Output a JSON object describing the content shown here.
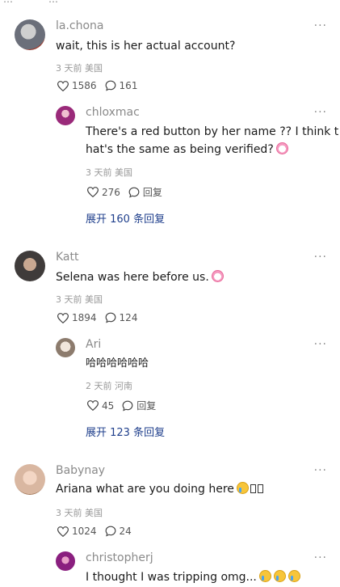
{
  "top_fragment": [
    "…",
    "…"
  ],
  "comments": [
    {
      "username": "la.chona",
      "text": "wait, this is her actual account?",
      "meta": "3 天前 美国",
      "likes": "1586",
      "replies": "161",
      "avatar_color": "#6b6f7a",
      "reply": {
        "username": "chloxmac",
        "text_line1": "There's a red button by her name ?? I think t",
        "text_line2": "hat's the same as being verified?",
        "meta": "3 天前 美国",
        "likes": "276",
        "reply_label": "回复",
        "avatar_color": "#9a2a7a"
      },
      "expand": "展开 160 条回复"
    },
    {
      "username": "Katt",
      "text": "Selena was here before us.",
      "meta": "3 天前 美国",
      "likes": "1894",
      "replies": "124",
      "avatar_color": "#3f3b3a",
      "reply": {
        "username": "Ari",
        "text_line1": "哈哈哈哈哈哈",
        "meta": "2 天前 河南",
        "likes": "45",
        "reply_label": "回复",
        "avatar_color": "#b8a99b"
      },
      "expand": "展开 123 条回复"
    },
    {
      "username": "Babynay",
      "text": "Ariana what are you doing here",
      "meta": "3 天前 美国",
      "likes": "1024",
      "replies": "24",
      "avatar_color": "#d9b7a1",
      "reply": {
        "username": "christopherj",
        "text_line1": "I thought I was tripping omg...",
        "avatar_color": "#8a1f7f"
      }
    }
  ],
  "more_label": "···"
}
